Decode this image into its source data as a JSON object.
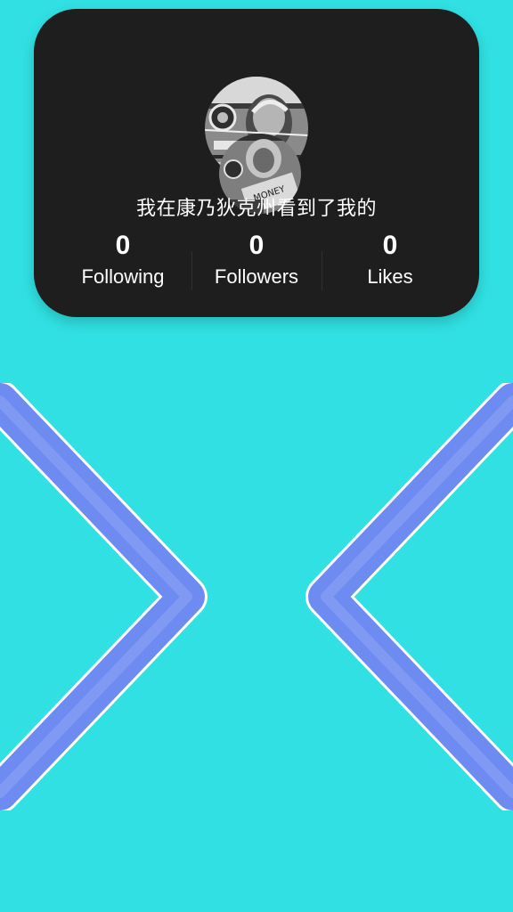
{
  "colors": {
    "background": "#30E0E2",
    "card": "#1F1E1F",
    "text": "#FFFFFF",
    "chevron_stroke": "#6E8BF2",
    "chevron_outline": "#FFFFFF"
  },
  "profile": {
    "username": "我在康乃狄克州看到了我的",
    "stats": [
      {
        "count": "0",
        "label": "Following"
      },
      {
        "count": "0",
        "label": "Followers"
      },
      {
        "count": "0",
        "label": "Likes"
      }
    ]
  },
  "navigation": {
    "previous_icon": "chevron-left-icon",
    "next_icon": "chevron-right-icon"
  }
}
